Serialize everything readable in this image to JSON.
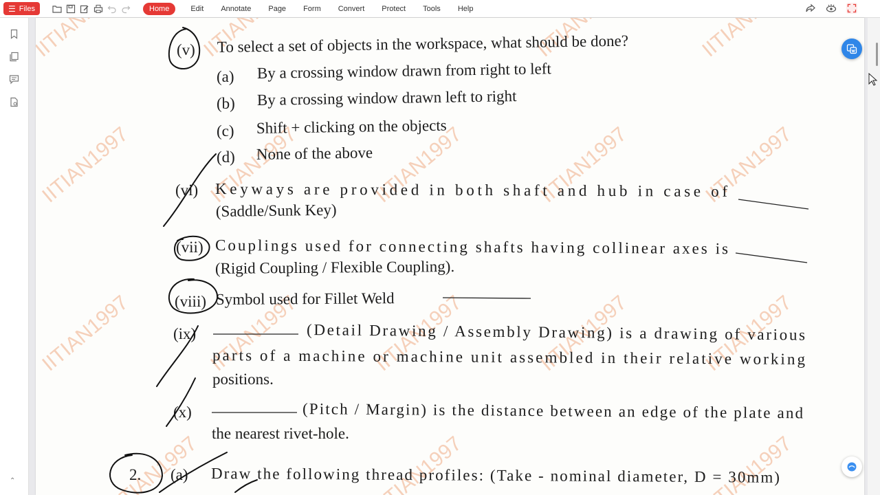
{
  "toolbar": {
    "files_label": "Files",
    "menu": [
      "Home",
      "Edit",
      "Annotate",
      "Page",
      "Form",
      "Convert",
      "Protect",
      "Tools",
      "Help"
    ],
    "active_menu": "Home"
  },
  "watermark": "IITIAN1997",
  "document": {
    "q5": {
      "number": "(v)",
      "text": "To select a set of objects in the workspace, what should be done?",
      "options": [
        {
          "label": "(a)",
          "text": "By a crossing window drawn from right to left"
        },
        {
          "label": "(b)",
          "text": "By a crossing window drawn left to right"
        },
        {
          "label": "(c)",
          "text": "Shift + clicking on the objects"
        },
        {
          "label": "(d)",
          "text": "None of the above"
        }
      ]
    },
    "q6": {
      "number": "(vi)",
      "line1": "Keyways are provided in both shaft and hub in case of",
      "line2": "(Saddle/Sunk Key)"
    },
    "q7": {
      "number": "(vii)",
      "line1": "Couplings used for connecting shafts having collinear axes is",
      "line2": "(Rigid Coupling / Flexible Coupling)."
    },
    "q8": {
      "number": "(viii)",
      "text": "Symbol used for Fillet Weld"
    },
    "q9": {
      "number": "(ix)",
      "line1": "(Detail Drawing / Assembly Drawing) is a drawing of various",
      "line2": "parts of a machine or machine unit assembled in their relative working",
      "line3": "positions."
    },
    "q10": {
      "number": "(x)",
      "line1": "(Pitch / Margin) is the distance between an edge of the plate and",
      "line2": "the nearest rivet-hole."
    },
    "q2": {
      "number": "2.",
      "sub": "(a)",
      "text": "Draw the following thread profiles: (Take - nominal diameter, D = 30mm)"
    }
  }
}
